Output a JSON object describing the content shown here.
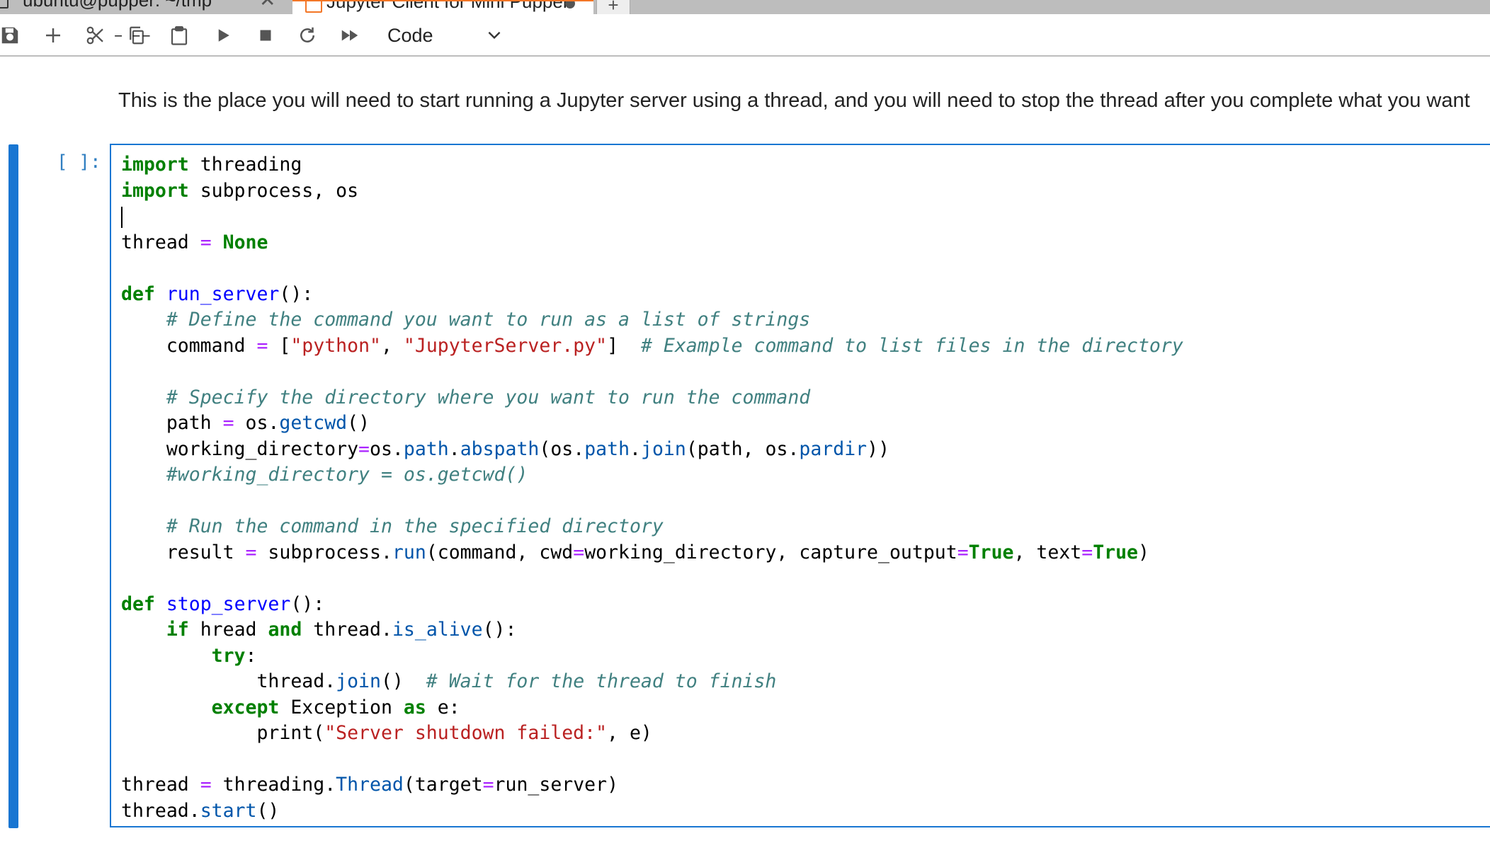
{
  "tabs": [
    {
      "label": "ubuntu@pupper: ~/tmp",
      "close": "✕",
      "icon": "terminal-icon"
    },
    {
      "label": "Jupyter Client for Mini Pupper",
      "icon": "notebook-icon",
      "dirty": true
    }
  ],
  "toolbar": {
    "buttons": [
      "save-icon",
      "add-cell-icon",
      "cut-icon",
      "copy-icon",
      "paste-icon",
      "run-icon",
      "stop-icon",
      "restart-icon",
      "run-all-icon"
    ],
    "cell_type": "Code"
  },
  "markdown": {
    "description": "This is the place you will need to start running a Jupyter server using a thread, and you will need to stop the thread after you complete what you want"
  },
  "code_cell": {
    "prompt": "[ ]:",
    "lines": [
      "import threading",
      "import subprocess, os",
      "",
      "thread = None",
      "",
      "def run_server():",
      "    # Define the command you want to run as a list of strings",
      "    command = [\"python\", \"JupyterServer.py\"]  # Example command to list files in the directory",
      "",
      "    # Specify the directory where you want to run the command",
      "    path = os.getcwd()",
      "    working_directory=os.path.abspath(os.path.join(path, os.pardir))",
      "    #working_directory = os.getcwd()",
      "",
      "    # Run the command in the specified directory",
      "    result = subprocess.run(command, cwd=working_directory, capture_output=True, text=True)",
      "",
      "def stop_server():",
      "    if hread and thread.is_alive():",
      "        try:",
      "            thread.join()  # Wait for the thread to finish",
      "        except Exception as e:",
      "            print(\"Server shutdown failed:\", e)",
      "",
      "thread = threading.Thread(target=run_server)",
      "thread.start()"
    ]
  },
  "colors": {
    "accent": "#1976d2",
    "keyword": "#008000",
    "string": "#ba2121",
    "comment": "#408080",
    "function": "#0000ff",
    "operator": "#aa22ff"
  }
}
